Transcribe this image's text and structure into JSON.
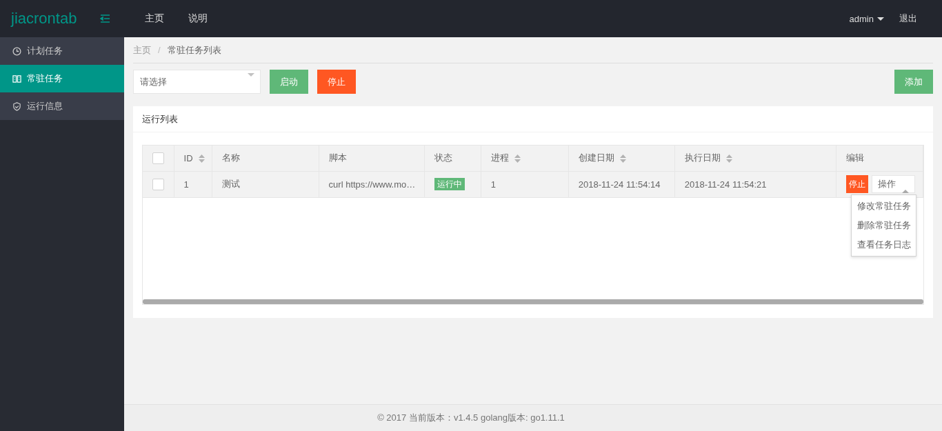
{
  "header": {
    "logo": "jiacrontab",
    "nav": [
      {
        "label": "主页"
      },
      {
        "label": "说明"
      }
    ],
    "user": "admin",
    "logout": "退出"
  },
  "sidebar": {
    "items": [
      {
        "label": "计划任务",
        "selected": false
      },
      {
        "label": "常驻任务",
        "selected": true
      },
      {
        "label": "运行信息",
        "selected": false
      }
    ]
  },
  "breadcrumb": {
    "items": [
      "主页",
      "常驻任务列表"
    ],
    "separator": "/"
  },
  "toolbar": {
    "select": {
      "placeholder": "请选择"
    },
    "buttons": [
      {
        "label": "启动",
        "kind": "start"
      },
      {
        "label": "停止",
        "kind": "stop"
      }
    ],
    "add": "添加"
  },
  "panel": {
    "title": "运行列表"
  },
  "table": {
    "header_checkbox": {
      "checked": false
    },
    "columns": [
      {
        "label": "ID",
        "sortable": true
      },
      {
        "label": "名称",
        "sortable": false
      },
      {
        "label": "脚本",
        "sortable": false
      },
      {
        "label": "状态",
        "sortable": false
      },
      {
        "label": "进程",
        "sortable": true
      },
      {
        "label": "创建日期",
        "sortable": true
      },
      {
        "label": "执行日期",
        "sortable": true
      },
      {
        "label": "编辑",
        "sortable": false
      }
    ],
    "rows": [
      {
        "checked": false,
        "cells": [
          "1",
          "测试",
          "curl https://www.mo…"
        ],
        "status": "运行中",
        "process": "1",
        "created": "2018-11-24 11:54:14",
        "executed": "2018-11-24 11:54:21",
        "stop": "停止",
        "actions": {
          "label": "操作",
          "expanded": true,
          "menu": [
            "修改常驻任务",
            "删除常驻任务",
            "查看任务日志"
          ]
        }
      }
    ]
  },
  "footer": "© 2017 当前版本：v1.4.5 golang版本: go1.11.1"
}
